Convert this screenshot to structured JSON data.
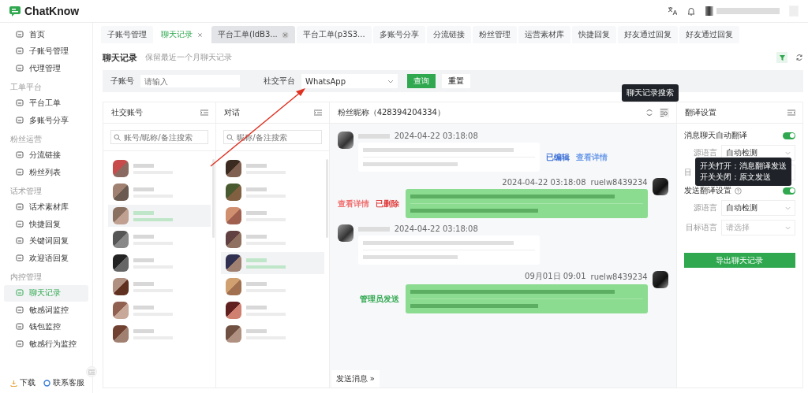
{
  "brand": "ChatKnow",
  "sidebar": {
    "sections": [
      {
        "items": [
          {
            "label": "首页",
            "selected": false
          },
          {
            "label": "子账号管理",
            "selected": false
          },
          {
            "label": "代理管理",
            "selected": false
          }
        ]
      },
      {
        "title": "工单平台",
        "items": [
          {
            "label": "平台工单",
            "selected": false
          },
          {
            "label": "多账号分享",
            "selected": false
          }
        ]
      },
      {
        "title": "粉丝运营",
        "items": [
          {
            "label": "分流链接",
            "selected": false
          },
          {
            "label": "粉丝列表",
            "selected": false
          }
        ]
      },
      {
        "title": "话术管理",
        "items": [
          {
            "label": "话术素材库",
            "selected": false
          },
          {
            "label": "快捷回复",
            "selected": false
          },
          {
            "label": "关键词回复",
            "selected": false
          },
          {
            "label": "欢迎语回复",
            "selected": false
          }
        ]
      },
      {
        "title": "内控管理",
        "items": [
          {
            "label": "聊天记录",
            "selected": true
          },
          {
            "label": "敏感词监控",
            "selected": false
          },
          {
            "label": "钱包监控",
            "selected": false
          },
          {
            "label": "敏感行为监控",
            "selected": false
          }
        ]
      }
    ],
    "footer": [
      "下载",
      "联系客服"
    ]
  },
  "tabs": [
    {
      "label": "子账号管理",
      "selected": false,
      "closable": false,
      "hovered": false
    },
    {
      "label": "聊天记录",
      "selected": true,
      "closable": true,
      "hovered": false
    },
    {
      "label": "平台工单(ldB3...",
      "selected": false,
      "closable": true,
      "hovered": true
    },
    {
      "label": "平台工单(p3S3...",
      "selected": false,
      "closable": false,
      "hovered": false
    },
    {
      "label": "多账号分享",
      "selected": false,
      "closable": false,
      "hovered": false
    },
    {
      "label": "分流链接",
      "selected": false,
      "closable": false,
      "hovered": false
    },
    {
      "label": "粉丝管理",
      "selected": false,
      "closable": false,
      "hovered": false
    },
    {
      "label": "运营素材库",
      "selected": false,
      "closable": false,
      "hovered": false
    },
    {
      "label": "快捷回复",
      "selected": false,
      "closable": false,
      "hovered": false
    },
    {
      "label": "好友通过回复",
      "selected": false,
      "closable": false,
      "hovered": false
    },
    {
      "label": "好友通过回复",
      "selected": false,
      "closable": false,
      "hovered": false
    }
  ],
  "page": {
    "title": "聊天记录",
    "subtitle": "保留最近一个月聊天记录"
  },
  "filter": {
    "account_label": "子账号",
    "account_placeholder": "请输入",
    "platform_label": "社交平台",
    "platform_value": "WhatsApp",
    "search_button": "查询",
    "reset_button": "重置"
  },
  "accounts_panel": {
    "title": "社交账号",
    "search_placeholder": "账号/昵称/备注搜索",
    "items": [
      {
        "selected": false
      },
      {
        "selected": false
      },
      {
        "selected": true
      },
      {
        "selected": false
      },
      {
        "selected": false
      },
      {
        "selected": false
      },
      {
        "selected": false
      },
      {
        "selected": false
      }
    ]
  },
  "conversations_panel": {
    "title": "对话",
    "search_placeholder": "昵称/备注搜索",
    "items": [
      {
        "selected": false
      },
      {
        "selected": false
      },
      {
        "selected": false
      },
      {
        "selected": false
      },
      {
        "selected": true
      },
      {
        "selected": false
      },
      {
        "selected": false
      },
      {
        "selected": false
      }
    ]
  },
  "chat": {
    "title": "粉丝昵称（428394204334）",
    "search_tooltip": "聊天记录搜索",
    "send_label": "发送消息 »",
    "messages": [
      {
        "kind": "incoming",
        "time": "2024-04-22 03:18:08",
        "actions": [
          {
            "label": "已编辑",
            "color": "#3b6fd6"
          },
          {
            "label": "查看详情",
            "color": "#6c9be8"
          }
        ]
      },
      {
        "kind": "outgoing",
        "time": "2024-04-22 03:18:08",
        "sender": "ruelw8439234",
        "actions": [
          {
            "label": "查看详情",
            "color": "#f07070"
          },
          {
            "label": "已删除",
            "color": "#e04040"
          }
        ]
      },
      {
        "kind": "incoming",
        "time": "2024-04-22 03:18:08"
      },
      {
        "kind": "outgoing",
        "time": "09月01日 09:01",
        "sender": "ruelw8439234",
        "actions": [
          {
            "label": "管理员发送",
            "color": "#2fa84f"
          }
        ]
      }
    ]
  },
  "translate": {
    "title": "翻译设置",
    "sections": [
      {
        "label": "消息聊天自动翻译",
        "help": false,
        "on": true,
        "rows": [
          {
            "label": "源语言",
            "value": "自动检测",
            "covered": false
          },
          {
            "label": "目",
            "covered": true
          }
        ]
      },
      {
        "label": "发送翻译设置",
        "help": true,
        "on": true,
        "rows": [
          {
            "label": "源语言",
            "value": "自动检测",
            "covered": false
          },
          {
            "label": "目标语言",
            "placeholder": "请选择",
            "covered": false
          }
        ]
      }
    ],
    "tooltip": [
      "开关打开：消息翻译发送",
      "开关关闭：原文发送"
    ],
    "export_button": "导出聊天记录"
  }
}
